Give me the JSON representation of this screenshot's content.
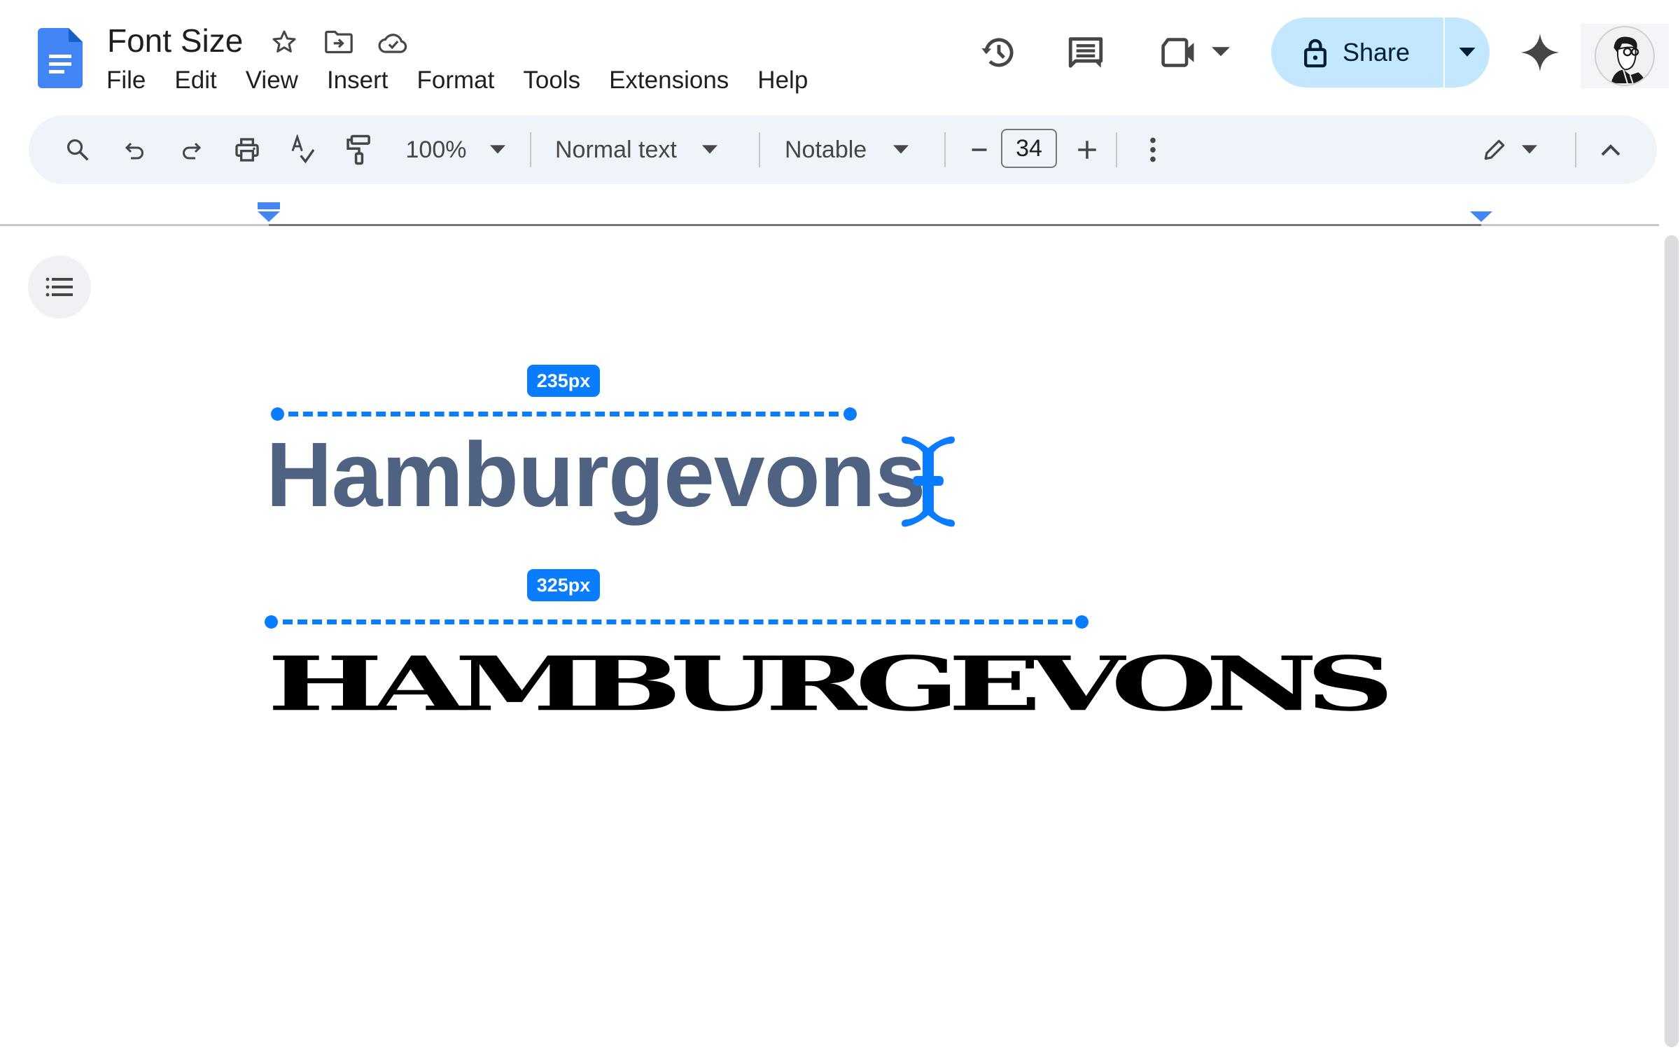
{
  "app": {
    "document_title": "Font Size",
    "title_icons": [
      "star-icon",
      "move-to-folder-icon",
      "cloud-saved-icon"
    ],
    "menu": [
      "File",
      "Edit",
      "View",
      "Insert",
      "Format",
      "Tools",
      "Extensions",
      "Help"
    ]
  },
  "header_actions": {
    "icons": [
      "version-history-icon",
      "comments-icon",
      "meet-icon"
    ],
    "share_label": "Share",
    "share_color": "#c2e7ff",
    "gemini_icon": "gemini-sparkle-icon",
    "avatar": "user-avatar"
  },
  "toolbar": {
    "zoom": "100%",
    "style": "Normal text",
    "font": "Notable",
    "font_size": "34",
    "decrease_label": "−",
    "increase_label": "+"
  },
  "document": {
    "measurements": [
      {
        "label": "235px",
        "color": "#0a7cff"
      },
      {
        "label": "325px",
        "color": "#0a7cff"
      }
    ],
    "samples": [
      {
        "text": "Hamburgevons",
        "color": "#4f6281"
      },
      {
        "text": "HAMBURGEVONS",
        "color": "#000000"
      }
    ]
  }
}
